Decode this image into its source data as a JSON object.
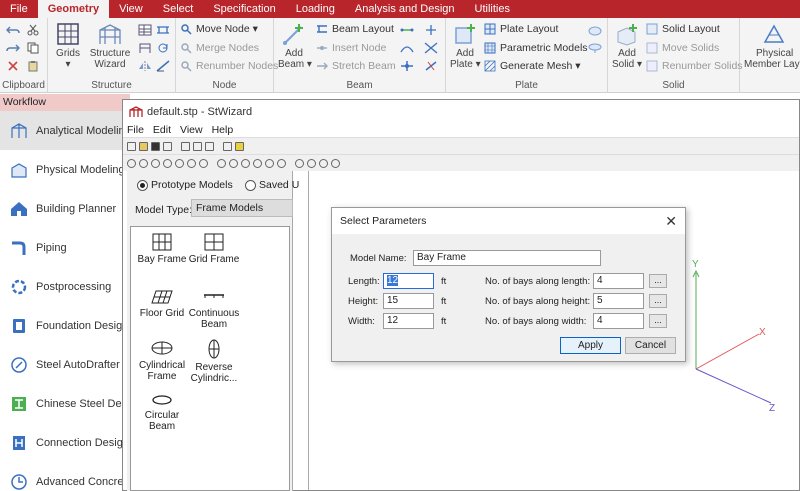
{
  "menubar": [
    "File",
    "Geometry",
    "View",
    "Select",
    "Specification",
    "Loading",
    "Analysis and Design",
    "Utilities"
  ],
  "menubar_active": "Geometry",
  "ribbon": {
    "clipboard": {
      "label": "Clipboard"
    },
    "structure": {
      "label": "Structure",
      "grids": "Grids",
      "wizard_line1": "Structure",
      "wizard_line2": "Wizard"
    },
    "node": {
      "label": "Node",
      "move": "Move Node",
      "merge": "Merge Nodes",
      "renumber": "Renumber Nodes"
    },
    "beam": {
      "label": "Beam",
      "add_line1": "Add",
      "add_line2": "Beam",
      "layout": "Beam Layout",
      "insert": "Insert Node",
      "stretch": "Stretch Beam"
    },
    "plate": {
      "label": "Plate",
      "add_line1": "Add",
      "add_line2": "Plate",
      "layout": "Plate Layout",
      "parametric": "Parametric Models",
      "mesh": "Generate Mesh"
    },
    "solid": {
      "label": "Solid",
      "add_line1": "Add",
      "add_line2": "Solid",
      "layout": "Solid Layout",
      "move": "Move Solids",
      "renumber": "Renumber Solids"
    },
    "physical": {
      "line1": "Physical",
      "line2": "Member Lay"
    }
  },
  "workflow": {
    "header": "Workflow",
    "items": [
      "Analytical Modeling",
      "Physical Modeling",
      "Building Planner",
      "Piping",
      "Postprocessing",
      "Foundation Design",
      "Steel AutoDrafter",
      "Chinese Steel Design",
      "Connection Design",
      "Advanced Concrete"
    ]
  },
  "stwizard": {
    "title": "default.stp - StWizard",
    "menu": [
      "File",
      "Edit",
      "View",
      "Help"
    ],
    "radio_prototype": "Prototype Models",
    "radio_saved": "Saved U",
    "model_type_label": "Model Type:",
    "model_type_value": "Frame Models",
    "models": [
      {
        "line1": "Bay Frame",
        "line2": ""
      },
      {
        "line1": "Grid Frame",
        "line2": ""
      },
      {
        "line1": "Floor Grid",
        "line2": ""
      },
      {
        "line1": "Continuous",
        "line2": "Beam"
      },
      {
        "line1": "Cylindrical",
        "line2": "Frame"
      },
      {
        "line1": "Reverse",
        "line2": "Cylindric..."
      },
      {
        "line1": "Circular",
        "line2": "Beam"
      }
    ],
    "axes": {
      "y": "Y",
      "x": "X",
      "z": "Z"
    }
  },
  "dialog": {
    "title": "Select Parameters",
    "model_name_label": "Model Name:",
    "model_name_value": "Bay Frame",
    "length_label": "Length:",
    "length_value": "12",
    "height_label": "Height:",
    "height_value": "15",
    "width_label": "Width:",
    "width_value": "12",
    "unit": "ft",
    "bays_length_label": "No. of bays along length:",
    "bays_length_value": "4",
    "bays_height_label": "No. of bays along height:",
    "bays_height_value": "5",
    "bays_width_label": "No. of bays along width:",
    "bays_width_value": "4",
    "dots": "...",
    "apply": "Apply",
    "cancel": "Cancel"
  },
  "colors": {
    "brand": "#b8252b",
    "accent": "#2a6ad8",
    "axis_y": "#55aa55",
    "axis_x": "#e05555",
    "axis_z": "#6a55c8"
  }
}
